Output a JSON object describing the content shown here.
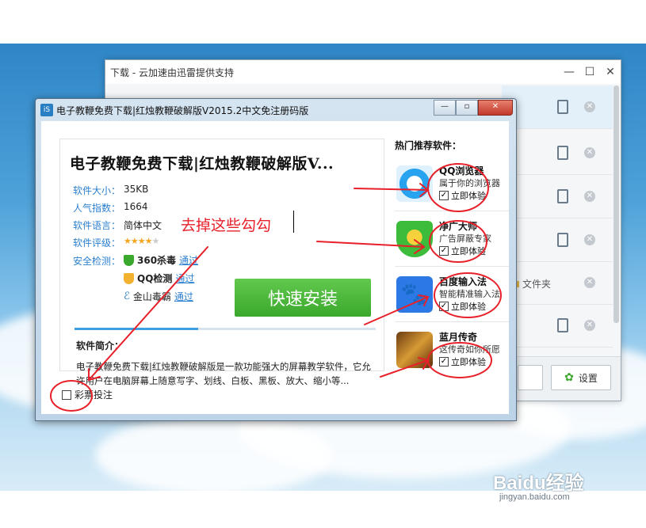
{
  "download_window": {
    "title": "下载 - 云加速由迅雷提供支持",
    "folder_label": "文件夹",
    "settings_label": "设置"
  },
  "installer": {
    "title": "电子教鞭免费下载|红烛教鞭破解版V2015.2中文免注册码版",
    "software_name": "电子教鞭免费下载|红烛教鞭破解版V...",
    "meta": [
      {
        "label": "软件大小：",
        "value": "35KB"
      },
      {
        "label": "人气指数：",
        "value": "1664"
      },
      {
        "label": "软件语言：",
        "value": "简体中文"
      },
      {
        "label": "软件评级：",
        "value": ""
      }
    ],
    "rating_stars": 4,
    "rating_max": 5,
    "security_label": "安全检测：",
    "checks": [
      {
        "name": "360杀毒",
        "status": "通过"
      },
      {
        "name": "QQ检测",
        "status": "通过"
      },
      {
        "name": "金山毒霸",
        "status": "通过"
      }
    ],
    "install_button": "快速安装",
    "progress_fraction": 0.41,
    "intro_heading": "软件简介：",
    "intro_text": "电子教鞭免费下载|红烛教鞭破解版是一款功能强大的屏幕教学软件，它允许用户在电脑屏幕上随意写字、划线、白板、黑板、放大、缩小等...",
    "support_label": "彩票投注",
    "support_checked": false,
    "recommend_heading": "热门推荐软件：",
    "recommendations": [
      {
        "name": "QQ浏览器",
        "desc": "属于你的浏览器",
        "check_label": "立即体验",
        "checked": true
      },
      {
        "name": "净广大师",
        "desc": "广告屏蔽专家",
        "check_label": "立即体验",
        "checked": true
      },
      {
        "name": "百度输入法",
        "desc": "智能精准输入法",
        "check_label": "立即体验",
        "checked": true
      },
      {
        "name": "蓝月传奇",
        "desc": "这传奇如你所愿",
        "check_label": "立即体验",
        "checked": true
      }
    ]
  },
  "annotation": {
    "text": "去掉这些勾勾",
    "color": "#e8202a"
  },
  "watermark": {
    "brand": "Baidu经验",
    "url": "jingyan.baidu.com"
  },
  "colors": {
    "install_green": "#3aa82c",
    "link_blue": "#2b7fcf"
  }
}
